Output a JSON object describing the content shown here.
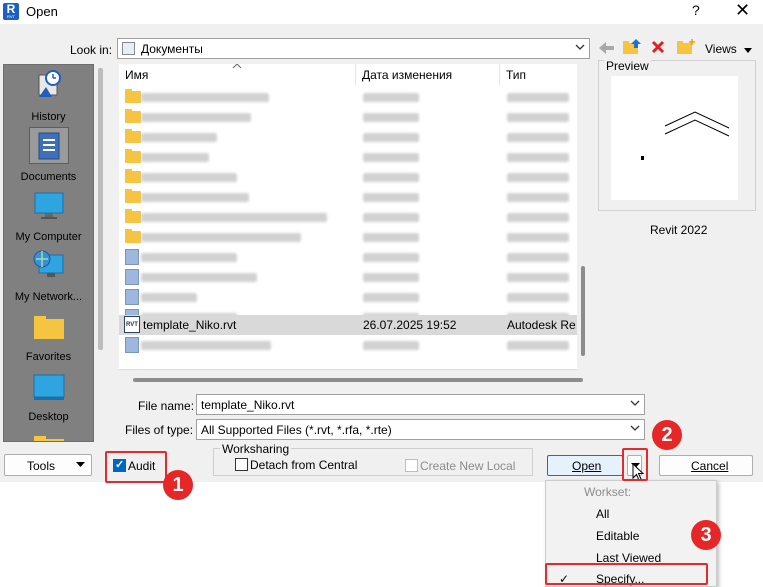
{
  "window": {
    "title": "Open",
    "help": "?",
    "close": "✕",
    "app_icon_letter": "R",
    "app_icon_sub": "RVT"
  },
  "toolbar": {
    "look_in_label": "Look in:",
    "look_in_value": "Документы",
    "views_label": "Views"
  },
  "places": [
    {
      "label": "History",
      "icon": "history-icon"
    },
    {
      "label": "Documents",
      "icon": "documents-icon",
      "selected": true
    },
    {
      "label": "My Computer",
      "icon": "computer-icon"
    },
    {
      "label": "My Network...",
      "icon": "network-icon"
    },
    {
      "label": "Favorites",
      "icon": "favorites-folder-icon"
    },
    {
      "label": "Desktop",
      "icon": "desktop-icon"
    }
  ],
  "columns": [
    "Имя",
    "Дата изменения",
    "Тип"
  ],
  "files": {
    "selected": {
      "name": "template_Niko.rvt",
      "date": "26.07.2025 19:52",
      "type": "Autodesk Re",
      "icon_text": "RVT"
    }
  },
  "preview": {
    "label": "Preview",
    "version": "Revit 2022"
  },
  "form": {
    "file_name_label": "File name:",
    "file_name_value": "template_Niko.rvt",
    "files_of_type_label": "Files of type:",
    "files_of_type_value": "All Supported Files (*.rvt, *.rfa, *.rte)"
  },
  "bottom": {
    "tools_label": "Tools",
    "audit_label": "Audit",
    "audit_checked": true,
    "worksharing_label": "Worksharing",
    "detach_label": "Detach from Central",
    "create_new_local_label": "Create New Local",
    "open_label": "Open",
    "cancel_label": "Cancel"
  },
  "open_menu": {
    "header": "Workset:",
    "items": [
      "All",
      "Editable",
      "Last Viewed",
      "Specify..."
    ],
    "checked_item": "Specify..."
  },
  "annotations": {
    "badge1": "1",
    "badge2": "2",
    "badge3": "3",
    "highlight_color": "#e22b2b"
  }
}
